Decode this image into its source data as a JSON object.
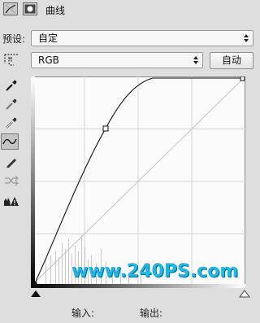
{
  "header": {
    "title": "曲线"
  },
  "preset": {
    "label": "预设:",
    "value": "自定"
  },
  "channel": {
    "value": "RGB"
  },
  "auto_button": {
    "label": "自动"
  },
  "tools": [
    "eyedropper-black-icon",
    "eyedropper-gray-icon",
    "eyedropper-white-icon",
    "curve-point-icon",
    "pencil-icon",
    "smooth-icon",
    "clipping-warning-icon"
  ],
  "footer": {
    "input_label": "输入:",
    "output_label": "输出:"
  },
  "watermark": "www.240PS.com",
  "colors": {
    "background": "#dedede",
    "graph_bg": "#fbfbfb",
    "curve": "#000000",
    "watermark": "#1fb7e3"
  }
}
